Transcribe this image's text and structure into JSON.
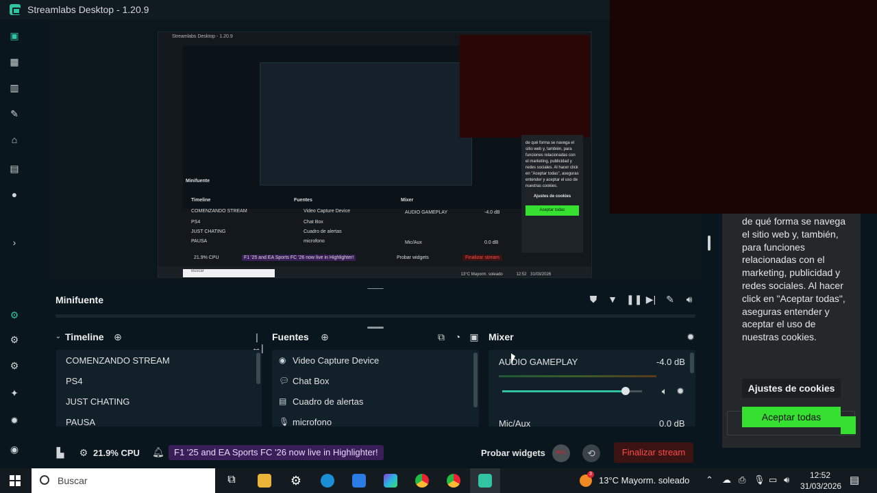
{
  "window": {
    "title": "Streamlabs Desktop - 1.20.9"
  },
  "preview": {
    "title": "Streamlabs Desktop - 1.20.9",
    "minifuente": "Minifuente",
    "timeline": "Timeline",
    "fuentes": "Fuentes",
    "mixer": "Mixer",
    "scenes": [
      "COMENZANDO STREAM",
      "PS4",
      "JUST CHATING",
      "PAUSA"
    ],
    "sources": [
      "Video Capture Device",
      "Chat Box",
      "Cuadro de alertas",
      "microfono"
    ],
    "audio1": "AUDIO GAMEPLAY",
    "audio1_db": "-4.0 dB",
    "audio2": "Mic/Aux",
    "audio2_db": "0.0 dB",
    "cpu": "21.9% CPU",
    "notification": "F1 '25 and EA Sports FC '26 now live in Highlighter!",
    "probar": "Probar widgets",
    "finalizar": "Finalizar stream",
    "search": "Buscar",
    "weather": "13°C  Mayorm. soleado",
    "time": "12:52",
    "date": "31/03/2026",
    "cookie_text": "de qué forma se navega el sitio web y, también, para funciones relacionadas con el marketing, publicidad y redes sociales. Al hacer click en \"Aceptar todas\", aseguras entender y aceptar el uso de nuestras cookies.",
    "cookie_settings": "Ajustes de cookies",
    "cookie_accept": "Aceptar todas"
  },
  "cookie": {
    "text": "de qué forma se navega el sitio web y, también, para funciones relacionadas con el marketing, publicidad y redes sociales. Al hacer click en \"Aceptar todas\", aseguras entender y aceptar el uso de nuestras cookies.",
    "settings": "Ajustes de cookies",
    "accept": "Aceptar todas"
  },
  "minifuente": {
    "title": "Minifuente"
  },
  "timeline": {
    "title": "Timeline",
    "scenes": [
      "COMENZANDO STREAM",
      "PS4",
      "JUST CHATING",
      "PAUSA"
    ]
  },
  "fuentes": {
    "title": "Fuentes",
    "items": [
      "Video Capture Device",
      "Chat Box",
      "Cuadro de alertas",
      "microfono"
    ]
  },
  "mixer": {
    "title": "Mixer",
    "channels": [
      {
        "name": "AUDIO GAMEPLAY",
        "db": "-4.0 dB",
        "volume": 0.88
      },
      {
        "name": "Mic/Aux",
        "db": "0.0 dB"
      }
    ]
  },
  "footer": {
    "cpu": "21.9% CPU",
    "notification": "F1 '25 and EA Sports FC '26 now live in Highlighter!",
    "probar": "Probar widgets",
    "rec": "REC",
    "finalizar": "Finalizar stream"
  },
  "taskbar": {
    "search_placeholder": "Buscar",
    "weather": "13°C  Mayorm. soleado",
    "time": "12:52",
    "date": "31/03/2026",
    "weather_badge": "3"
  },
  "colors": {
    "accent": "#31c3a2",
    "cookie_button": "#35e031",
    "danger": "#ff4a4a",
    "highlight": "#3a1e58"
  }
}
